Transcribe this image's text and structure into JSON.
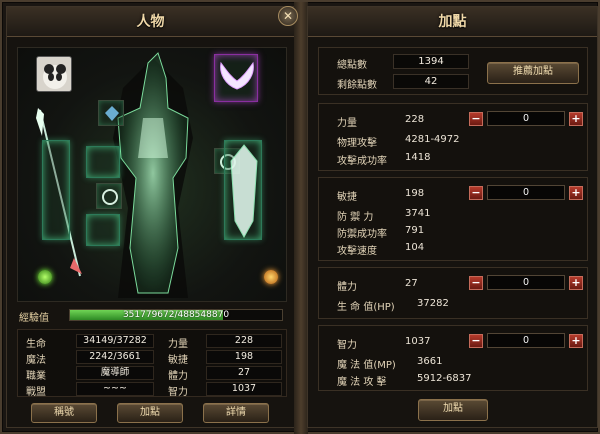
{
  "left": {
    "title": "人物",
    "exp": {
      "label": "經驗值",
      "text": "351779672/488548870",
      "fraction": 0.72
    },
    "stats": [
      {
        "label": "生命",
        "value": "34149/37282"
      },
      {
        "label": "魔法",
        "value": "2242/3661"
      },
      {
        "label": "職業",
        "value": "魔導師"
      },
      {
        "label": "戰盟",
        "value": "~~~"
      }
    ],
    "attrs": [
      {
        "label": "力量",
        "value": "228"
      },
      {
        "label": "敏捷",
        "value": "198"
      },
      {
        "label": "體力",
        "value": "27"
      },
      {
        "label": "智力",
        "value": "1037"
      }
    ],
    "buttons": {
      "title": "稱號",
      "add": "加點",
      "detail": "詳情"
    }
  },
  "right": {
    "title": "加點",
    "total_label": "總點數",
    "total": "1394",
    "remain_label": "剩餘點數",
    "remain": "42",
    "recommend": "推薦加點",
    "groups": [
      {
        "name": "力量",
        "value": "228",
        "input": "0",
        "rows": [
          {
            "label": "物理攻擊",
            "value": "4281-4972"
          },
          {
            "label": "攻擊成功率",
            "value": "1418"
          }
        ]
      },
      {
        "name": "敏捷",
        "value": "198",
        "input": "0",
        "rows": [
          {
            "label": "防 禦 力",
            "value": "3741"
          },
          {
            "label": "防禦成功率",
            "value": "791"
          },
          {
            "label": "攻擊速度",
            "value": "104"
          }
        ]
      },
      {
        "name": "體力",
        "value": "27",
        "input": "0",
        "rows": [
          {
            "label": "生 命 值(HP)",
            "value": "37282"
          }
        ]
      },
      {
        "name": "智力",
        "value": "1037",
        "input": "0",
        "rows": [
          {
            "label": "魔 法 值(MP)",
            "value": "3661"
          },
          {
            "label": "魔 法 攻 擊",
            "value": "5912-6837"
          }
        ]
      }
    ],
    "confirm": "加點",
    "minus": "−",
    "plus": "+"
  },
  "colors": {
    "exp_fill": "#4fbf3c",
    "slot_glow": "#5affaa",
    "wing_glow": "#dc50ff",
    "minus_plus": "#b53a2b"
  },
  "icons": [
    "close-icon",
    "avatar-icon",
    "wing-icon",
    "spear-icon",
    "shield-icon",
    "ring-icon",
    "amulet-icon",
    "green-orb-icon",
    "orange-orb-icon"
  ]
}
